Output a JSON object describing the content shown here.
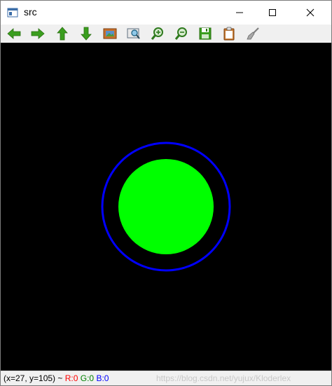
{
  "window": {
    "title": "src",
    "controls": {
      "minimize_icon": "minimize-icon",
      "maximize_icon": "maximize-icon",
      "close_icon": "close-icon"
    }
  },
  "toolbar": {
    "tools": [
      {
        "id": "pan-left",
        "icon": "arrow-left-icon"
      },
      {
        "id": "pan-right",
        "icon": "arrow-right-icon"
      },
      {
        "id": "pan-up",
        "icon": "arrow-up-icon"
      },
      {
        "id": "pan-down",
        "icon": "arrow-down-icon"
      },
      {
        "id": "zoom-original",
        "icon": "image-icon"
      },
      {
        "id": "zoom-fit",
        "icon": "zoom-fit-icon"
      },
      {
        "id": "zoom-in",
        "icon": "zoom-in-icon"
      },
      {
        "id": "zoom-out",
        "icon": "zoom-out-icon"
      },
      {
        "id": "save",
        "icon": "save-icon"
      },
      {
        "id": "copy",
        "icon": "clipboard-icon"
      },
      {
        "id": "properties",
        "icon": "brush-icon"
      }
    ]
  },
  "canvas": {
    "background": "#000000",
    "shapes": {
      "outer_ring_color": "#0000ff",
      "inner_disc_color": "#00ff00"
    }
  },
  "status": {
    "coords": "(x=27, y=105) ~",
    "r": "R:0",
    "g": "G:0",
    "b": "B:0",
    "watermark": "https://blog.csdn.net/yujux/Kloderlex"
  },
  "colors": {
    "r_label": "#ff0000",
    "g_label": "#008000",
    "b_label": "#0000ff",
    "toolbar_arrow": "#3a9e1e"
  }
}
